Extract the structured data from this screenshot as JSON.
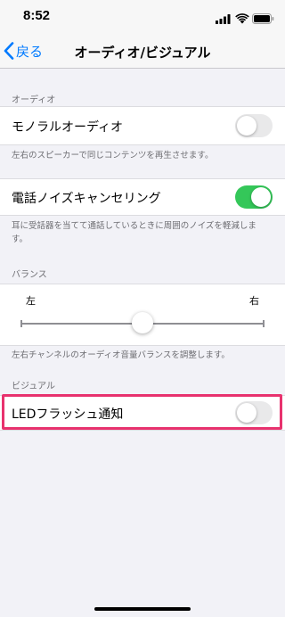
{
  "status_bar": {
    "time": "8:52"
  },
  "nav": {
    "back_label": "戻る",
    "title": "オーディオ/ビジュアル"
  },
  "audio_section": {
    "header": "オーディオ",
    "mono_label": "モノラルオーディオ",
    "mono_enabled": false,
    "mono_footer": "左右のスピーカーで同じコンテンツを再生させます。",
    "noise_label": "電話ノイズキャンセリング",
    "noise_enabled": true,
    "noise_footer": "耳に受話器を当てて通話しているときに周囲のノイズを軽減します。"
  },
  "balance_section": {
    "header": "バランス",
    "left_label": "左",
    "right_label": "右",
    "value": 0.5,
    "footer": "左右チャンネルのオーディオ音量バランスを調整します。"
  },
  "visual_section": {
    "header": "ビジュアル",
    "led_label": "LEDフラッシュ通知",
    "led_enabled": false
  },
  "colors": {
    "accent": "#007aff",
    "toggle_on": "#34c759",
    "highlight": "#e8326e"
  }
}
